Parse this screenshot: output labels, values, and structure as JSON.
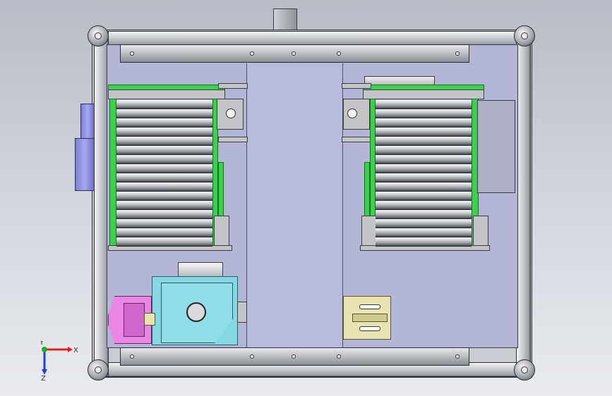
{
  "axis_triad": {
    "x_label": "X",
    "y_label": "Y",
    "z_label": "Z",
    "x_color": "#e02020",
    "y_color": "#20b020",
    "z_color": "#2040d0"
  },
  "colors": {
    "frame": "#c9ccd2",
    "panel": "#b4b6d6",
    "conveyor_frame": "#3bd24b",
    "motor": "#7e7fd4",
    "cylinder_block": "#84d8e3",
    "gripper": "#ec86e6",
    "slide_plate": "#e8e3b0"
  }
}
